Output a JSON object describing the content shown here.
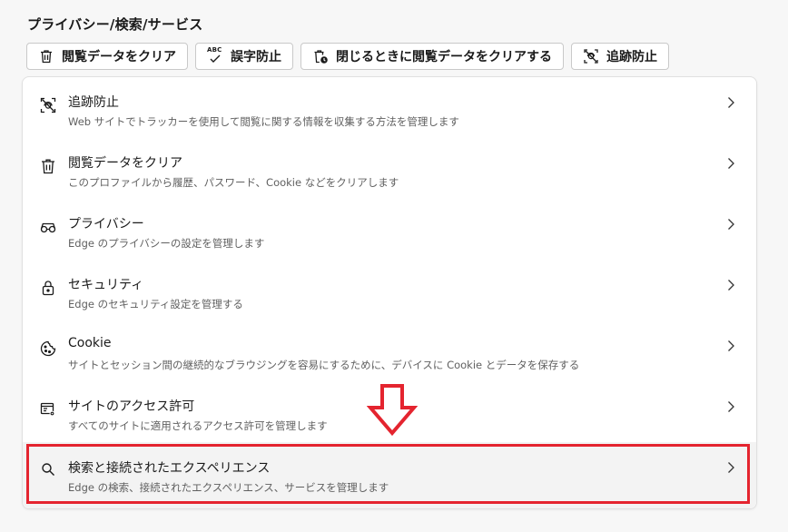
{
  "page": {
    "title": "プライバシー/検索/サービス"
  },
  "quick_actions": [
    {
      "label": "閲覧データをクリア",
      "icon": "trash-icon"
    },
    {
      "label": "誤字防止",
      "icon": "spellcheck-icon",
      "badge": "ABC"
    },
    {
      "label": "閉じるときに閲覧データをクリアする",
      "icon": "trash-clock-icon"
    },
    {
      "label": "追跡防止",
      "icon": "tracking-prevention-icon"
    }
  ],
  "settings": [
    {
      "title": "追跡防止",
      "description": "Web サイトでトラッカーを使用して閲覧に関する情報を収集する方法を管理します",
      "icon": "tracking-prevention-icon"
    },
    {
      "title": "閲覧データをクリア",
      "description": "このプロファイルから履歴、パスワード、Cookie などをクリアします",
      "icon": "trash-icon"
    },
    {
      "title": "プライバシー",
      "description": "Edge のプライバシーの設定を管理します",
      "icon": "glasses-icon"
    },
    {
      "title": "セキュリティ",
      "description": "Edge のセキュリティ設定を管理する",
      "icon": "lock-icon"
    },
    {
      "title": "Cookie",
      "description": "サイトとセッション間の継続的なブラウジングを容易にするために、デバイスに Cookie とデータを保存する",
      "icon": "cookie-icon"
    },
    {
      "title": "サイトのアクセス許可",
      "description": "すべてのサイトに適用されるアクセス許可を管理します",
      "icon": "site-permissions-icon"
    },
    {
      "title": "検索と接続されたエクスペリエンス",
      "description": "Edge の検索、接続されたエクスペリエンス、サービスを管理します",
      "icon": "search-icon"
    }
  ],
  "annotation": {
    "highlight_color": "#e4242f",
    "highlighted_item": "検索と接続されたエクスペリエンス"
  }
}
